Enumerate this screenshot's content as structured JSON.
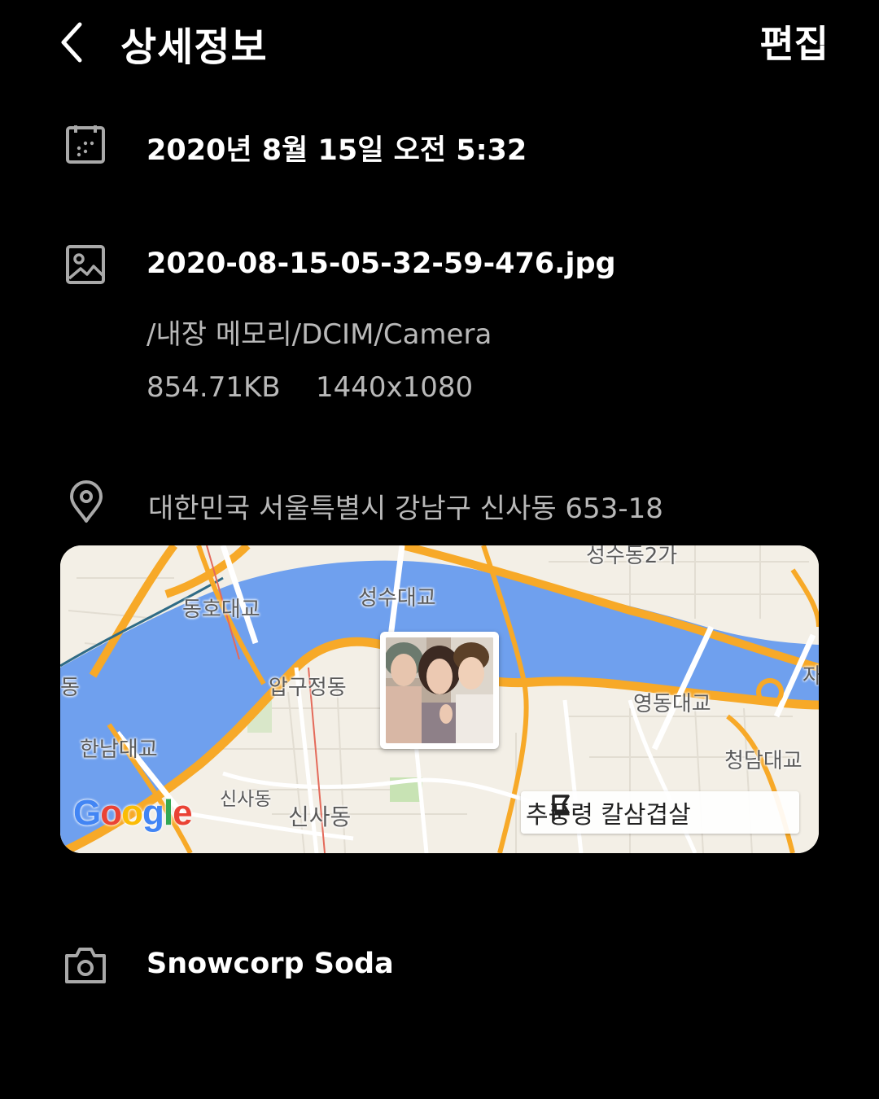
{
  "header": {
    "title": "상세정보",
    "edit_label": "편집"
  },
  "date_row": {
    "icon": "calendar-icon",
    "datetime": "2020년 8월 15일 오전 5:32"
  },
  "file_row": {
    "icon": "image-icon",
    "filename": "2020-08-15-05-32-59-476.jpg",
    "path": "/내장 메모리/DCIM/Camera",
    "size": "854.71KB",
    "resolution": "1440x1080"
  },
  "location_row": {
    "icon": "location-pin-icon",
    "address": "대한민국 서울특별시 강남구 신사동 653-18"
  },
  "map": {
    "labels": {
      "dongho_bridge": "동호대교",
      "seongsu_bridge": "성수대교",
      "seongsu_dong": "성수동2가",
      "apgujeong": "압구정동",
      "yeongdong_bridge": "영동대교",
      "hannam_bridge": "한남대교",
      "cheongdam_bridge": "청담대교",
      "sinsa_station": "신사동",
      "sinsa_dong": "신사동",
      "left_cut": "동",
      "right_cut": "자"
    },
    "google_logo": "Google",
    "place_chip": "추풍령 칼삼겹살",
    "colors": {
      "water": "#6fa0ee",
      "land": "#f3efe6",
      "highway": "#f7a928",
      "road": "#ffffff"
    }
  },
  "camera_row": {
    "icon": "camera-icon",
    "model": "Snowcorp Soda"
  }
}
